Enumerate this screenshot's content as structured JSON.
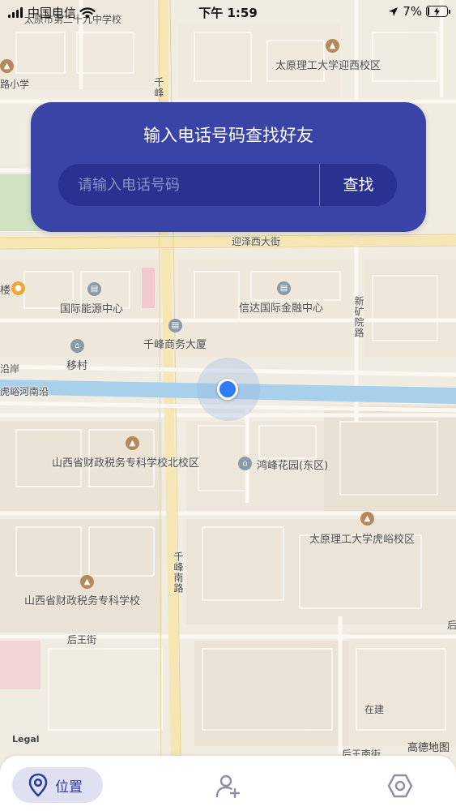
{
  "status_bar": {
    "carrier": "中国电信",
    "time": "下午 1:59",
    "battery": "7%",
    "battery_level": 0.07
  },
  "search": {
    "title": "输入电话号码查找好友",
    "placeholder": "请输入电话号码",
    "button_label": "查找"
  },
  "map": {
    "labels": {
      "school_29": "太原市第二十九中学校",
      "school_fragment": "路小学",
      "tyut_west": "太原理工大学迎西校区",
      "road_yingze": "迎泽西大街",
      "road_qianfeng_top": "千峰",
      "international_energy": "国际能源中心",
      "xinda": "信达国际金融中心",
      "road_xinkuang": "新矿院路",
      "qianfeng_business": "千峰商务大厦",
      "mall_fragment": "楼",
      "yancun": "移村",
      "yanan_fragment": "沿岸",
      "huyu_river": "虎峪河南沿",
      "shanxi_finance_north": "山西省财政税务专科学校北校区",
      "hongfeng": "鸿峰花园(东区)",
      "tyut_huyu": "太原理工大学虎峪校区",
      "road_qianfeng_south": "千峰南路",
      "shanxi_finance": "山西省财政税务专科学校",
      "houwang": "后王街",
      "zaijian": "在建",
      "houwang_south": "后王南街",
      "fragment_hou": "后"
    },
    "legal": "Legal",
    "attribution": "高德地图"
  },
  "tabs": {
    "location_label": "位置"
  },
  "colors": {
    "accent": "#3a43a6",
    "location_dot": "#2e7cf6",
    "tab_active_bg": "#dfe1f3"
  },
  "icons": {
    "location_tab": "map-pin-icon",
    "add_friend_tab": "add-user-icon",
    "settings_tab": "hexagon-settings-icon"
  }
}
